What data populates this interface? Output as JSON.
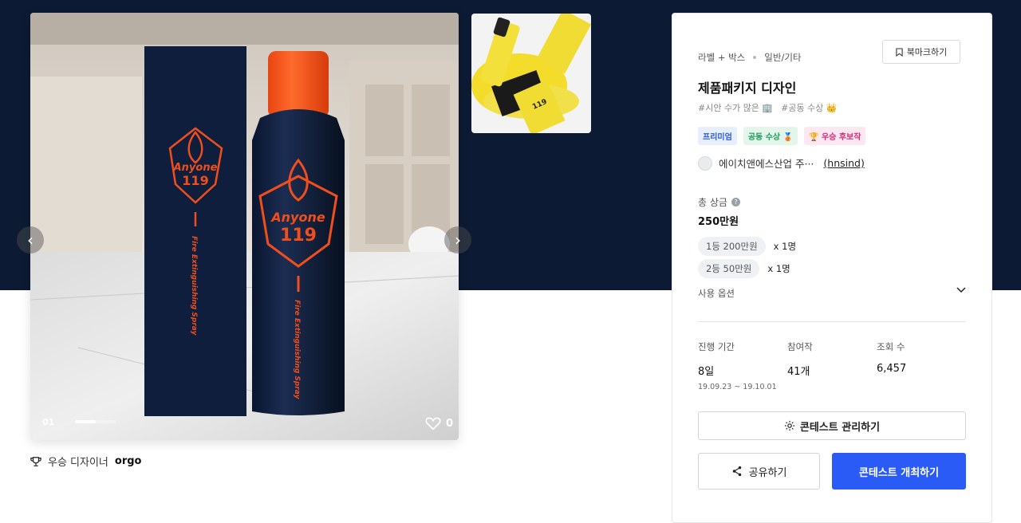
{
  "gallery": {
    "slide_index": "01",
    "slide_progress": 0.5,
    "like_count": "0",
    "main_image": {
      "box_text": "Anyone",
      "box_number": "119",
      "side_text": "Fire Extinguishing Spray",
      "brand_color": "#f04e1c",
      "box_color": "#0f1e3d"
    },
    "winner_label": "우승 디자이너",
    "winner_name": "orgo"
  },
  "contest": {
    "category_primary": "라벨 + 박스",
    "category_secondary": "일반/기타",
    "bookmark_label": "북마크하기",
    "title": "제품패키지 디자인",
    "tags": [
      "#시안 수가 많은 🏢",
      "#공동 수상 👑"
    ],
    "badges": [
      {
        "label": "프리미엄"
      },
      {
        "label": "공동 수상 🥉"
      },
      {
        "label": "🏆 우승 후보작"
      }
    ],
    "company_name": "에이치앤에스산업 주···",
    "company_handle": "(hnsind)",
    "prize_label": "총 상금",
    "prize_total": "250만원",
    "prizes": [
      {
        "rank": "1등 200만원",
        "count": "x 1명"
      },
      {
        "rank": "2등 50만원",
        "count": "x 1명"
      }
    ],
    "usage_label": "사용 옵션",
    "stats": {
      "period_label": "진행 기간",
      "period_value": "8일",
      "period_dates": "19.09.23 ~ 19.10.01",
      "entries_label": "참여작",
      "entries_value": "41개",
      "views_label": "조회 수",
      "views_value": "6,457"
    },
    "manage_label": "콘테스트 관리하기",
    "share_label": "공유하기",
    "host_label": "콘테스트 개최하기"
  }
}
